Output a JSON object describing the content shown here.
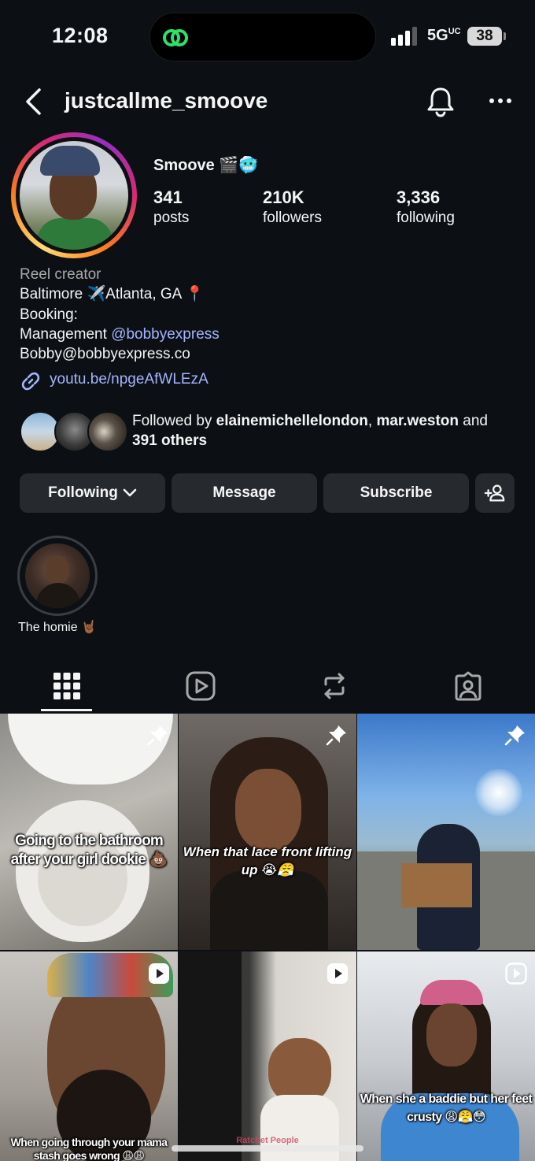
{
  "status_bar": {
    "time": "12:08",
    "network": "5G",
    "network_suffix": "UC",
    "battery": "38"
  },
  "header": {
    "username": "justcallme_smoove"
  },
  "profile": {
    "display_name": "Smoove 🎬🥶",
    "stats": [
      {
        "value": "341",
        "label": "posts"
      },
      {
        "value": "210K",
        "label": "followers"
      },
      {
        "value": "3,336",
        "label": "following"
      }
    ],
    "bio": {
      "category": "Reel creator",
      "line1": "Baltimore ✈️Atlanta, GA 📍",
      "line2": "Booking:",
      "line3_prefix": "Management ",
      "line3_mention": "@bobbyexpress",
      "line4": "Bobby@bobbyexpress.co"
    },
    "link": "youtu.be/npgeAfWLEzA",
    "followed_by": {
      "prefix": "Followed by ",
      "user1": "elainemichellelondon",
      "sep": ", ",
      "user2": "mar.weston",
      "suffix1": " and",
      "others": "391 others"
    }
  },
  "buttons": {
    "following": "Following",
    "message": "Message",
    "subscribe": "Subscribe"
  },
  "highlight": {
    "label": "The homie 🤘🏾"
  },
  "posts": [
    {
      "caption": "Going to the bathroom after your girl dookie 💩",
      "badge": "pin"
    },
    {
      "caption": "When that lace front lifting up 😭😤",
      "badge": "pin"
    },
    {
      "caption": "",
      "badge": "pin"
    },
    {
      "caption": "When going through your mama stash goes wrong 😩😩",
      "badge": "reel"
    },
    {
      "caption": "Ratchet People",
      "badge": "reel"
    },
    {
      "caption": "When she a baddie but her feet crusty 😩😤😳",
      "badge": "reel"
    }
  ],
  "colors": {
    "background": "#0c1014",
    "button": "#262a2f",
    "link": "#a3b4ff",
    "muted": "#a8a8a8"
  }
}
